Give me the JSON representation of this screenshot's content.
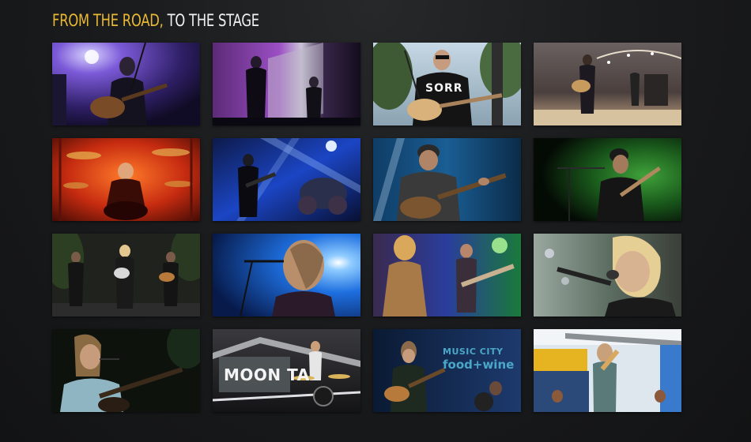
{
  "heading": {
    "accent": "FROM THE ROAD,",
    "rest": "TO THE STAGE",
    "accent_color": "#e9b934"
  },
  "gallery": {
    "thumbnails": [
      {
        "name": "photo-1"
      },
      {
        "name": "photo-2"
      },
      {
        "name": "photo-3",
        "shirt_text": "SORR"
      },
      {
        "name": "photo-4"
      },
      {
        "name": "photo-5"
      },
      {
        "name": "photo-6"
      },
      {
        "name": "photo-7"
      },
      {
        "name": "photo-8"
      },
      {
        "name": "photo-9"
      },
      {
        "name": "photo-10"
      },
      {
        "name": "photo-11"
      },
      {
        "name": "photo-12"
      },
      {
        "name": "photo-13"
      },
      {
        "name": "photo-14",
        "banner_text": "MOON TA"
      },
      {
        "name": "photo-15",
        "banner_line1": "MUSIC CITY",
        "banner_line2": "food+wine"
      },
      {
        "name": "photo-16"
      }
    ]
  }
}
